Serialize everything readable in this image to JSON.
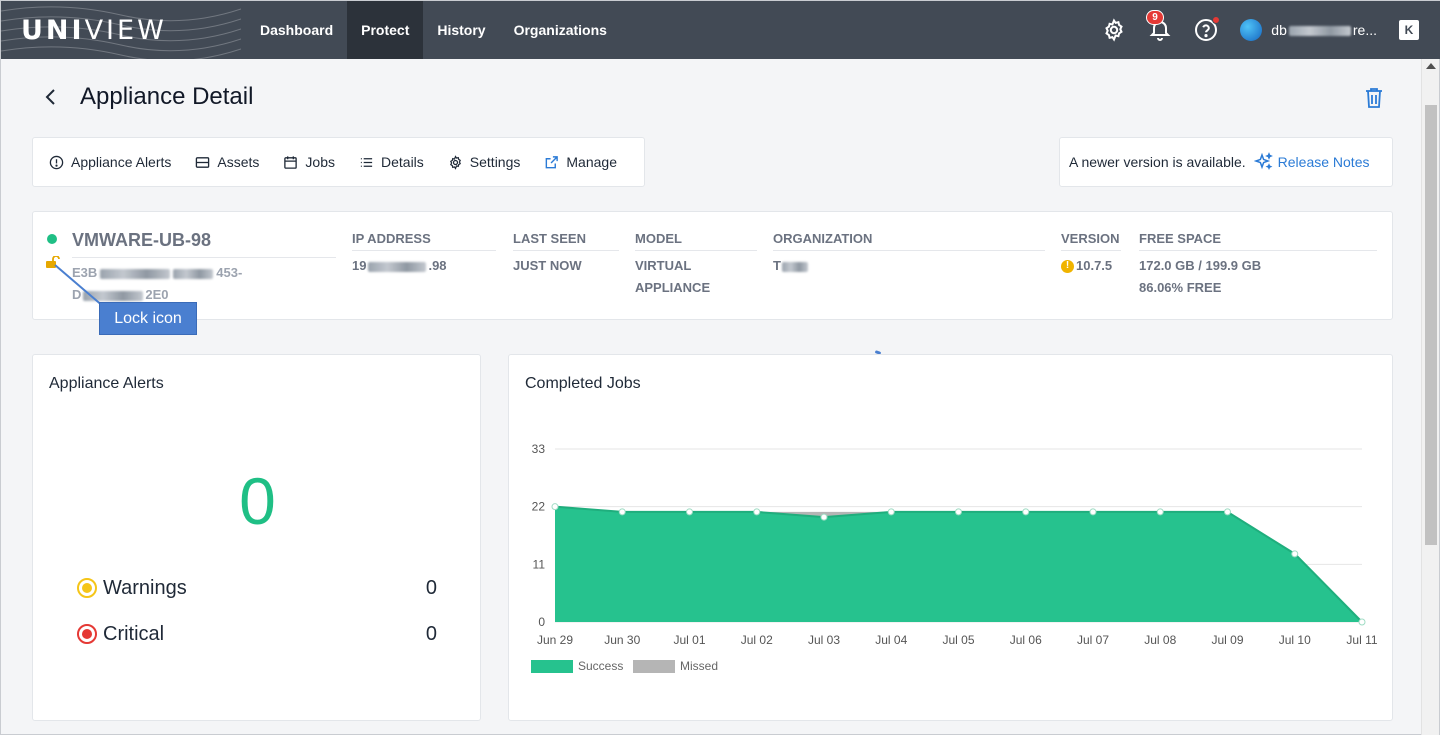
{
  "brand": {
    "logo_bold": "UNI",
    "logo_light": "VIEW"
  },
  "nav": {
    "items": [
      {
        "label": "Dashboard",
        "active": false
      },
      {
        "label": "Protect",
        "active": true
      },
      {
        "label": "History",
        "active": false
      },
      {
        "label": "Organizations",
        "active": false
      }
    ],
    "notification_count": "9",
    "user_name_start": "db",
    "user_name_end": "re...",
    "k_label": "K"
  },
  "page": {
    "title": "Appliance Detail"
  },
  "tabs": [
    {
      "label": "Appliance Alerts",
      "icon": "alert-circle-icon"
    },
    {
      "label": "Assets",
      "icon": "server-icon"
    },
    {
      "label": "Jobs",
      "icon": "calendar-icon"
    },
    {
      "label": "Details",
      "icon": "list-icon"
    },
    {
      "label": "Settings",
      "icon": "gear-icon"
    },
    {
      "label": "Manage",
      "icon": "external-link-icon"
    }
  ],
  "version_notice": {
    "text": "A newer version is available.",
    "link": "Release Notes"
  },
  "appliance": {
    "name": "VMWARE-UB-98",
    "id_start": "E3B",
    "id_mid": "453-",
    "id_line2_start": "D",
    "id_line2_end": "2E0",
    "ip_header": "IP ADDRESS",
    "ip_start": "19",
    "ip_end": ".98",
    "last_seen_header": "LAST SEEN",
    "last_seen": "JUST NOW",
    "model_header": "MODEL",
    "model_line1": "VIRTUAL",
    "model_line2": "APPLIANCE",
    "org_header": "ORGANIZATION",
    "org_start": "T",
    "version_header": "VERSION",
    "version": "10.7.5",
    "free_header": "FREE SPACE",
    "free_space": "172.0 GB / 199.9 GB",
    "free_pct": "86.06% FREE",
    "status_color": "#1fbf85",
    "lock_color": "#e6a800"
  },
  "callout": {
    "label": "Lock icon"
  },
  "alerts": {
    "title": "Appliance Alerts",
    "total": "0",
    "warnings_label": "Warnings",
    "warnings_count": "0",
    "critical_label": "Critical",
    "critical_count": "0",
    "warning_color": "#f5c518",
    "critical_color": "#e53935",
    "total_color": "#1fbf85"
  },
  "jobs": {
    "title": "Completed Jobs",
    "legend_success": "Success",
    "legend_missed": "Missed"
  },
  "chart_data": {
    "type": "area",
    "title": "Completed Jobs",
    "categories": [
      "Jun 29",
      "Jun 30",
      "Jul 01",
      "Jul 02",
      "Jul 03",
      "Jul 04",
      "Jul 05",
      "Jul 06",
      "Jul 07",
      "Jul 08",
      "Jul 09",
      "Jul 10",
      "Jul 11"
    ],
    "series": [
      {
        "name": "Success",
        "color": "#26c28e",
        "values": [
          22,
          21,
          21,
          21,
          20,
          21,
          21,
          21,
          21,
          21,
          21,
          13,
          0
        ]
      },
      {
        "name": "Missed",
        "color": "#b5b5b5",
        "values": [
          0,
          0,
          0,
          0,
          1,
          0,
          0,
          0,
          0,
          0,
          0,
          0,
          0
        ]
      }
    ],
    "stacked": true,
    "yticks": [
      0,
      11,
      22,
      33
    ],
    "ylim": [
      0,
      33
    ],
    "grid": true,
    "legend_position": "bottom-left"
  }
}
